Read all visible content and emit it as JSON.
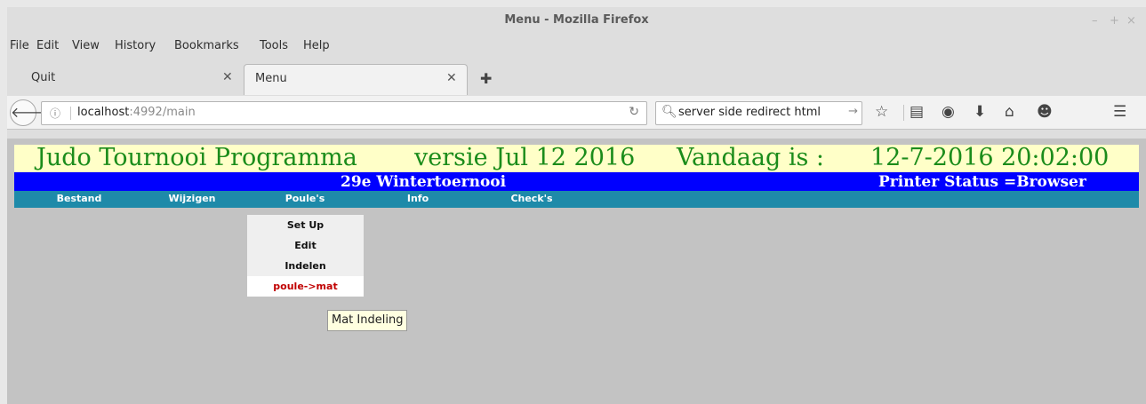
{
  "window": {
    "title": "Menu - Mozilla Firefox",
    "controls": [
      "–",
      "+",
      "×"
    ]
  },
  "menubar": [
    "File",
    "Edit",
    "View",
    "History",
    "Bookmarks",
    "Tools",
    "Help"
  ],
  "tabs": [
    {
      "label": "Quit",
      "active": false
    },
    {
      "label": "Menu",
      "active": true
    }
  ],
  "navbar": {
    "url_host": "localhost",
    "url_path": ":4992/main",
    "search_text": "server side redirect html"
  },
  "page": {
    "banner": {
      "app_name": "Judo Tournooi Programma",
      "version": "versie Jul 12 2016",
      "today_label": "Vandaag is :",
      "datetime": "12-7-2016 20:02:00"
    },
    "event_name": "29e Wintertoernooi",
    "printer_status": "Printer Status =Browser",
    "menu": [
      "Bestand",
      "Wijzigen",
      "Poule's",
      "Info",
      "Check's"
    ],
    "dropdown": [
      {
        "label": "Set Up",
        "highlighted": false
      },
      {
        "label": "Edit",
        "highlighted": false
      },
      {
        "label": "Indelen",
        "highlighted": false
      },
      {
        "label": "poule->mat",
        "highlighted": true
      }
    ],
    "tooltip": "Mat Indeling"
  },
  "colors": {
    "banner_bg": "#ffffc8",
    "banner_text": "#1b8c1b",
    "event_bar": "#0000ff",
    "nav_strip": "#1e8aa9",
    "highlight_text": "#c00000",
    "page_bg": "#c3c3c3"
  },
  "icons": [
    "back-arrow-icon",
    "info-icon",
    "reload-icon",
    "search-icon",
    "bookmark-star-icon",
    "reading-list-icon",
    "pocket-icon",
    "download-icon",
    "home-icon",
    "chat-icon",
    "hamburger-menu-icon",
    "close-tab-icon",
    "new-tab-icon"
  ]
}
